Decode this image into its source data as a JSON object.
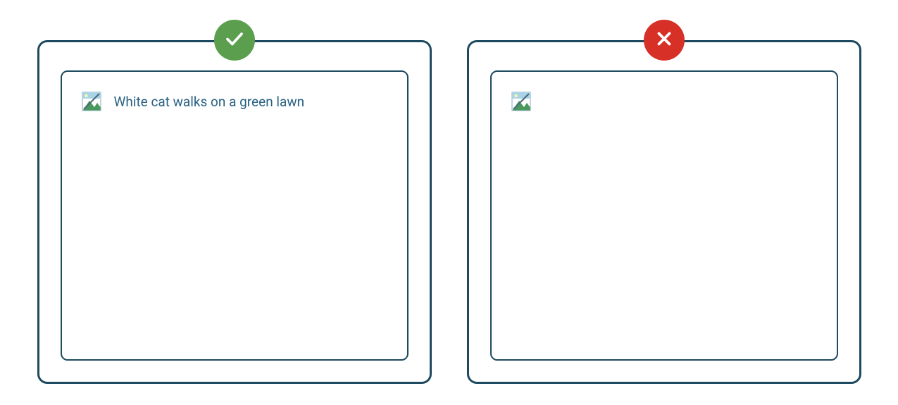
{
  "colors": {
    "frame_border": "#1e4a5f",
    "do_badge": "#5a9e4e",
    "dont_badge": "#d63027",
    "alt_text": "#2a6283"
  },
  "panels": {
    "do": {
      "status": "do",
      "alt_text": "White cat walks on a green lawn",
      "icon_name": "checkmark-icon"
    },
    "dont": {
      "status": "dont",
      "alt_text": "",
      "icon_name": "x-icon"
    }
  }
}
